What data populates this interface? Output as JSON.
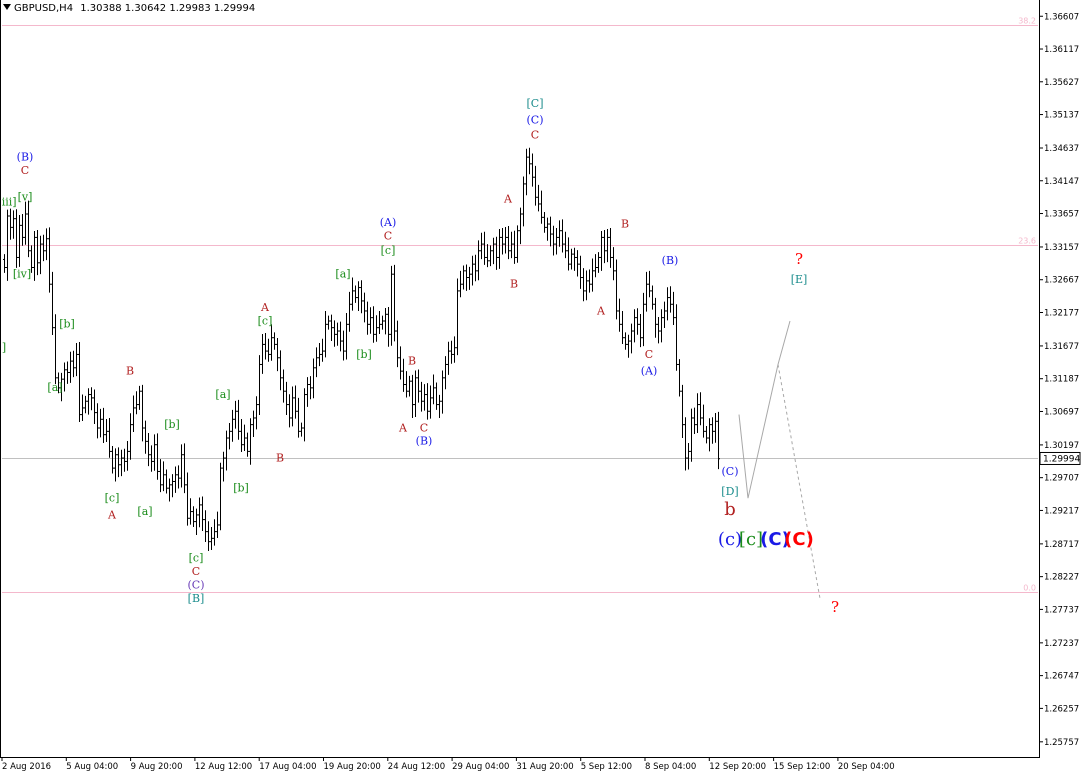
{
  "header": {
    "symbol_timeframe": "GBPUSD,H4",
    "ohlc": "1.30388 1.30642 1.29983 1.29994"
  },
  "colors": {
    "background": "#ffffff",
    "candles": "#000000",
    "fib_lines": "#f4b8cc",
    "current_price_line": "#c0c0c0",
    "dark_red": "#b22222",
    "blue": "#1a1ae6",
    "green": "#1a8c1a",
    "teal": "#1a8c8c",
    "purple": "#6a3db8",
    "red": "#ff0000"
  },
  "chart_data": {
    "type": "candlestick",
    "title": "GBPUSD,H4",
    "ylim": [
      1.2553,
      1.3685
    ],
    "y_ticks": [
      "1.36607",
      "1.36117",
      "1.35627",
      "1.35137",
      "1.34637",
      "1.34147",
      "1.33657",
      "1.33157",
      "1.32667",
      "1.32177",
      "1.31677",
      "1.31187",
      "1.30697",
      "1.30197",
      "1.29707",
      "1.29217",
      "1.28717",
      "1.28227",
      "1.27737",
      "1.27237",
      "1.26747",
      "1.26257",
      "1.25757"
    ],
    "y_tick_values": [
      1.36607,
      1.36117,
      1.35627,
      1.35137,
      1.34637,
      1.34147,
      1.33657,
      1.33157,
      1.32667,
      1.32177,
      1.31677,
      1.31187,
      1.30697,
      1.30197,
      1.29707,
      1.29217,
      1.28717,
      1.28227,
      1.27737,
      1.27237,
      1.26747,
      1.26257,
      1.25757
    ],
    "current_price": "1.29994",
    "current_price_value": 1.29994,
    "x_ticks": [
      "2 Aug 2016",
      "5 Aug 04:00",
      "9 Aug 20:00",
      "12 Aug 12:00",
      "17 Aug 04:00",
      "19 Aug 20:00",
      "24 Aug 12:00",
      "29 Aug 04:00",
      "31 Aug 20:00",
      "5 Sep 12:00",
      "8 Sep 04:00",
      "12 Sep 20:00",
      "15 Sep 12:00",
      "20 Sep 04:00"
    ],
    "fib_levels": [
      {
        "label": "38.2",
        "value": 1.3647
      },
      {
        "label": "23.6",
        "value": 1.3318
      },
      {
        "label": "0.0",
        "value": 1.28
      }
    ],
    "closes": [
      1.3285,
      1.3362,
      1.3345,
      1.3358,
      1.33,
      1.3348,
      1.333,
      1.3365,
      1.331,
      1.3285,
      1.333,
      1.3292,
      1.332,
      1.331,
      1.3328,
      1.326,
      1.3195,
      1.312,
      1.3105,
      1.3118,
      1.3132,
      1.3128,
      1.3145,
      1.3135,
      1.3155,
      1.3065,
      1.3075,
      1.3085,
      1.3095,
      1.309,
      1.3068,
      1.3045,
      1.3058,
      1.3035,
      1.304,
      1.301,
      1.2985,
      1.3005,
      1.299,
      1.3,
      1.2995,
      1.301,
      1.305,
      1.3075,
      1.308,
      1.31,
      1.3045,
      1.3025,
      1.3005,
      1.2995,
      1.302,
      1.298,
      1.296,
      1.2975,
      1.2955,
      1.296,
      1.2965,
      1.2975,
      1.297,
      1.3005,
      1.296,
      1.291,
      1.292,
      1.2905,
      1.2915,
      1.293,
      1.2908,
      1.289,
      1.2875,
      1.288,
      1.289,
      1.29,
      1.2985,
      1.3,
      1.303,
      1.304,
      1.3058,
      1.307,
      1.304,
      1.302,
      1.303,
      1.301,
      1.305,
      1.306,
      1.308,
      1.314,
      1.317,
      1.316,
      1.3155,
      1.318,
      1.317,
      1.315,
      1.312,
      1.31,
      1.308,
      1.306,
      1.309,
      1.307,
      1.304,
      1.3045,
      1.3095,
      1.311,
      1.3105,
      1.3135,
      1.315,
      1.3155,
      1.316,
      1.32,
      1.3205,
      1.3195,
      1.3185,
      1.319,
      1.3175,
      1.316,
      1.32,
      1.323,
      1.325,
      1.324,
      1.3255,
      1.3235,
      1.322,
      1.32,
      1.321,
      1.3185,
      1.3195,
      1.32,
      1.3205,
      1.3215,
      1.3185,
      1.3275,
      1.319,
      1.315,
      1.313,
      1.311,
      1.31,
      1.3115,
      1.308,
      1.312,
      1.31,
      1.3085,
      1.3095,
      1.307,
      1.309,
      1.3105,
      1.308,
      1.3085,
      1.312,
      1.314,
      1.316,
      1.3155,
      1.3165,
      1.325,
      1.326,
      1.328,
      1.327,
      1.3275,
      1.329,
      1.328,
      1.331,
      1.332,
      1.33,
      1.3295,
      1.331,
      1.332,
      1.33,
      1.333,
      1.332,
      1.333,
      1.331,
      1.332,
      1.33,
      1.334,
      1.3365,
      1.341,
      1.345,
      1.344,
      1.342,
      1.339,
      1.338,
      1.336,
      1.3345,
      1.335,
      1.3335,
      1.332,
      1.333,
      1.334,
      1.332,
      1.331,
      1.329,
      1.3305,
      1.33,
      1.329,
      1.327,
      1.325,
      1.3265,
      1.326,
      1.328,
      1.3285,
      1.33,
      1.333,
      1.331,
      1.333,
      1.33,
      1.328,
      1.322,
      1.32,
      1.318,
      1.317,
      1.3175,
      1.319,
      1.321,
      1.32,
      1.318,
      1.323,
      1.326,
      1.325,
      1.323,
      1.32,
      1.319,
      1.321,
      1.322,
      1.324,
      1.323,
      1.321,
      1.314,
      1.31,
      1.305,
      1.3,
      1.301,
      1.306,
      1.305,
      1.308,
      1.306,
      1.304,
      1.303,
      1.305,
      1.304,
      1.3055,
      1.2999
    ],
    "projection": [
      {
        "bar": 245,
        "price": 1.3065
      },
      {
        "bar": 248,
        "price": 1.294
      },
      {
        "bar": 258,
        "price": 1.314
      },
      {
        "bar": 262,
        "price": 1.3205
      }
    ],
    "projection_dashed": [
      {
        "bar": 258,
        "price": 1.314
      },
      {
        "bar": 272,
        "price": 1.279
      }
    ],
    "wave_labels": [
      {
        "text": "[iii]",
        "bar": 1,
        "price": 1.3378,
        "color": "green"
      },
      {
        "text": "(B)",
        "bar": 7,
        "price": 1.3445,
        "color": "blue"
      },
      {
        "text": "C",
        "bar": 7,
        "price": 1.3425,
        "color": "dark_red"
      },
      {
        "text": "[v]",
        "bar": 7,
        "price": 1.3385,
        "color": "green"
      },
      {
        "text": "[iv]",
        "bar": 6,
        "price": 1.327,
        "color": "green"
      },
      {
        "text": "]",
        "bar": 0,
        "price": 1.316,
        "color": "green"
      },
      {
        "text": "[b]",
        "bar": 21,
        "price": 1.3195,
        "color": "green"
      },
      {
        "text": "[a]",
        "bar": 17,
        "price": 1.31,
        "color": "green"
      },
      {
        "text": "B",
        "bar": 42,
        "price": 1.3125,
        "color": "dark_red"
      },
      {
        "text": "[c]",
        "bar": 36,
        "price": 1.2935,
        "color": "green"
      },
      {
        "text": "A",
        "bar": 36,
        "price": 1.291,
        "color": "dark_red"
      },
      {
        "text": "[b]",
        "bar": 56,
        "price": 1.3045,
        "color": "green"
      },
      {
        "text": "[a]",
        "bar": 47,
        "price": 1.2915,
        "color": "green"
      },
      {
        "text": "[a]",
        "bar": 73,
        "price": 1.309,
        "color": "green"
      },
      {
        "text": "[b]",
        "bar": 79,
        "price": 1.295,
        "color": "green"
      },
      {
        "text": "[c]",
        "bar": 64,
        "price": 1.2845,
        "color": "green"
      },
      {
        "text": "C",
        "bar": 64,
        "price": 1.2825,
        "color": "dark_red"
      },
      {
        "text": "(C)",
        "bar": 64,
        "price": 1.2805,
        "color": "purple"
      },
      {
        "text": "[B]",
        "bar": 64,
        "price": 1.2785,
        "color": "teal"
      },
      {
        "text": "A",
        "bar": 87,
        "price": 1.322,
        "color": "dark_red"
      },
      {
        "text": "[c]",
        "bar": 87,
        "price": 1.32,
        "color": "green"
      },
      {
        "text": "B",
        "bar": 92,
        "price": 1.2995,
        "color": "dark_red"
      },
      {
        "text": "[a]",
        "bar": 113,
        "price": 1.327,
        "color": "green"
      },
      {
        "text": "[b]",
        "bar": 120,
        "price": 1.315,
        "color": "green"
      },
      {
        "text": "(A)",
        "bar": 128,
        "price": 1.3347,
        "color": "blue"
      },
      {
        "text": "C",
        "bar": 128,
        "price": 1.3327,
        "color": "dark_red"
      },
      {
        "text": "[c]",
        "bar": 128,
        "price": 1.3305,
        "color": "green"
      },
      {
        "text": "B",
        "bar": 136,
        "price": 1.314,
        "color": "dark_red"
      },
      {
        "text": "A",
        "bar": 133,
        "price": 1.304,
        "color": "dark_red"
      },
      {
        "text": "C",
        "bar": 140,
        "price": 1.304,
        "color": "dark_red"
      },
      {
        "text": "(B)",
        "bar": 140,
        "price": 1.302,
        "color": "blue"
      },
      {
        "text": "A",
        "bar": 168,
        "price": 1.3382,
        "color": "dark_red"
      },
      {
        "text": "B",
        "bar": 170,
        "price": 1.3255,
        "color": "dark_red"
      },
      {
        "text": "[C]",
        "bar": 177,
        "price": 1.3525,
        "color": "teal"
      },
      {
        "text": "(C)",
        "bar": 177,
        "price": 1.35,
        "color": "blue"
      },
      {
        "text": "C",
        "bar": 177,
        "price": 1.3478,
        "color": "dark_red"
      },
      {
        "text": "B",
        "bar": 207,
        "price": 1.3345,
        "color": "dark_red"
      },
      {
        "text": "A",
        "bar": 199,
        "price": 1.3215,
        "color": "dark_red"
      },
      {
        "text": "(B)",
        "bar": 222,
        "price": 1.329,
        "color": "blue"
      },
      {
        "text": "C",
        "bar": 215,
        "price": 1.315,
        "color": "dark_red"
      },
      {
        "text": "(A)",
        "bar": 215,
        "price": 1.3125,
        "color": "blue"
      },
      {
        "text": "(C)",
        "bar": 242,
        "price": 1.2975,
        "color": "blue"
      },
      {
        "text": "[D]",
        "bar": 242,
        "price": 1.2945,
        "color": "teal"
      },
      {
        "text": "?",
        "bar": 265,
        "price": 1.329,
        "color": "red"
      },
      {
        "text": "[E]",
        "bar": 265,
        "price": 1.3262,
        "color": "teal"
      },
      {
        "text": "?",
        "bar": 277,
        "price": 1.277,
        "color": "red"
      }
    ],
    "large_labels": [
      {
        "text": "b",
        "bar": 242,
        "price": 1.2915,
        "color": "dark_red",
        "size": 18
      },
      {
        "text": "(c)",
        "bar": 242,
        "price": 1.287,
        "color": "blue",
        "size": 18
      },
      {
        "text": "[c]",
        "bar": 249,
        "price": 1.287,
        "color": "green",
        "size": 18
      },
      {
        "text": "(C)",
        "bar": 257,
        "price": 1.287,
        "color": "blue",
        "size": 18,
        "bold": true
      },
      {
        "text": "(C)",
        "bar": 265,
        "price": 1.287,
        "color": "red",
        "size": 18,
        "bold": true
      }
    ]
  }
}
